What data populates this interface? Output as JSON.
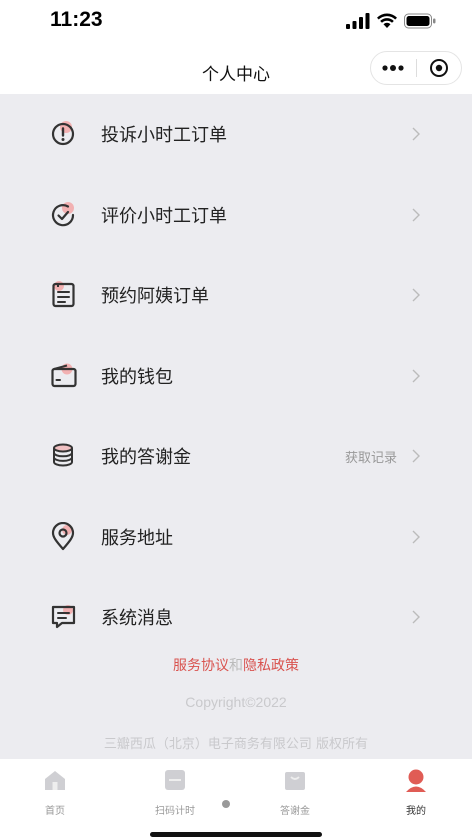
{
  "status_bar": {
    "time": "11:23"
  },
  "nav": {
    "title": "个人中心"
  },
  "menu": {
    "items": [
      {
        "label": "投诉小时工订单",
        "extra": ""
      },
      {
        "label": "评价小时工订单",
        "extra": ""
      },
      {
        "label": "预约阿姨订单",
        "extra": ""
      },
      {
        "label": "我的钱包",
        "extra": ""
      },
      {
        "label": "我的答谢金",
        "extra": "获取记录"
      },
      {
        "label": "服务地址",
        "extra": ""
      },
      {
        "label": "系统消息",
        "extra": ""
      }
    ]
  },
  "footer": {
    "agreement": "服务协议",
    "and": "和",
    "privacy": "隐私政策",
    "copyright": "Copyright©2022",
    "company": "三瓣西瓜（北京）电子商务有限公司 版权所有"
  },
  "tabs": [
    {
      "label": "首页",
      "icon": "home-icon"
    },
    {
      "label": "扫码计时",
      "icon": "scan-icon"
    },
    {
      "label": "答谢金",
      "icon": "gift-icon"
    },
    {
      "label": "我的",
      "icon": "user-icon"
    }
  ],
  "colors": {
    "accent": "#d9534f",
    "accent_light": "#f4a3a3",
    "background": "#ececf0"
  }
}
